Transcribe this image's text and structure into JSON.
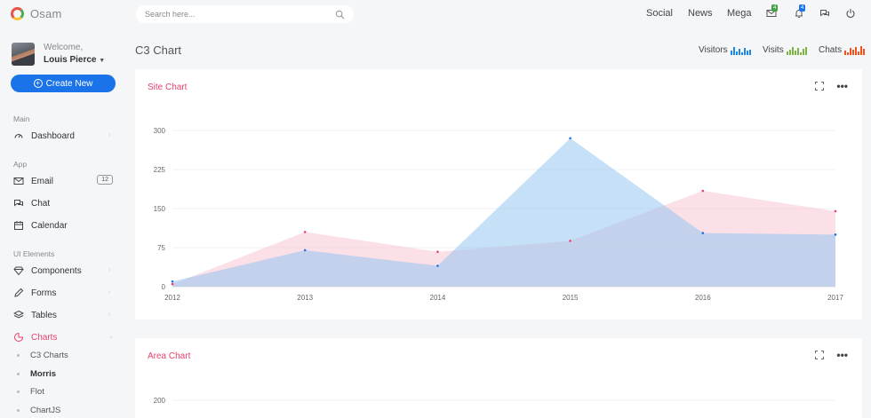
{
  "app": {
    "name": "Osam"
  },
  "search": {
    "placeholder": "Search here..."
  },
  "topnav": {
    "social": "Social",
    "news": "News",
    "mega": "Mega",
    "mail_badge": "4",
    "notif_badge": "4"
  },
  "user": {
    "welcome": "Welcome,",
    "name": "Louis Pierce"
  },
  "sidebar": {
    "create_label": "Create New",
    "sections": {
      "main": "Main",
      "app": "App",
      "ui": "UI Elements"
    },
    "items": [
      {
        "label": "Dashboard"
      },
      {
        "label": "Email",
        "count": "12"
      },
      {
        "label": "Chat"
      },
      {
        "label": "Calendar"
      },
      {
        "label": "Components"
      },
      {
        "label": "Forms"
      },
      {
        "label": "Tables"
      },
      {
        "label": "Charts"
      }
    ],
    "subitems": [
      {
        "label": "C3 Charts"
      },
      {
        "label": "Morris"
      },
      {
        "label": "Flot"
      },
      {
        "label": "ChartJS"
      }
    ]
  },
  "page": {
    "title": "C3 Chart"
  },
  "stats": [
    {
      "label": "Visitors",
      "color": "#1e88e5",
      "bars": [
        0.5,
        0.9,
        0.4,
        0.7,
        0.3,
        0.8,
        0.5,
        0.6
      ]
    },
    {
      "label": "Visits",
      "color": "#7cb342",
      "bars": [
        0.4,
        0.6,
        0.9,
        0.5,
        0.8,
        0.3,
        0.7,
        0.9
      ]
    },
    {
      "label": "Chats",
      "color": "#f4511e",
      "bars": [
        0.5,
        0.3,
        0.8,
        0.6,
        0.9,
        0.4,
        1.0,
        0.7
      ]
    }
  ],
  "cards": {
    "site_title": "Site Chart",
    "area_title": "Area Chart"
  },
  "colors": {
    "accent": "#e8416b",
    "primary": "#1a73e8"
  },
  "chart_data": [
    {
      "type": "area",
      "title": "Site Chart",
      "x": [
        "2012",
        "2013",
        "2014",
        "2015",
        "2016",
        "2017"
      ],
      "yticks": [
        0,
        75,
        150,
        225,
        300
      ],
      "ylim": [
        0,
        300
      ],
      "series": [
        {
          "values": [
            5,
            105,
            67,
            88,
            184,
            145
          ],
          "color": "#f8c9d4"
        },
        {
          "values": [
            10,
            70,
            40,
            285,
            103,
            100
          ],
          "color": "#8ec2f2"
        }
      ],
      "grid": true,
      "legend": "none"
    },
    {
      "type": "area",
      "title": "Area Chart",
      "yticks": [
        200
      ]
    }
  ]
}
